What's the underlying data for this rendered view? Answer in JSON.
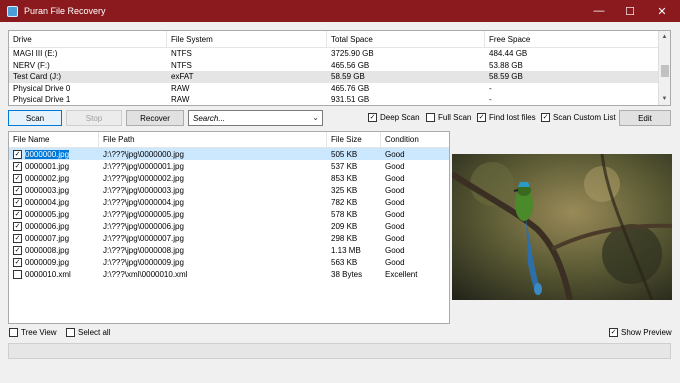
{
  "window": {
    "title": "Puran File Recovery",
    "minimize": "—",
    "maximize": "☐",
    "close": "✕"
  },
  "drives": {
    "columns": [
      "Drive",
      "File System",
      "Total Space",
      "Free Space"
    ],
    "rows": [
      [
        "MAGI III (E:)",
        "NTFS",
        "3725.90 GB",
        "484.44 GB"
      ],
      [
        "NERV (F:)",
        "NTFS",
        "465.56 GB",
        "53.88 GB"
      ],
      [
        "Test Card (J:)",
        "exFAT",
        "58.59 GB",
        "58.59 GB"
      ],
      [
        "Physical Drive 0",
        "RAW",
        "465.76 GB",
        "-"
      ],
      [
        "Physical Drive 1",
        "RAW",
        "931.51 GB",
        "-"
      ]
    ],
    "selected_index": 2
  },
  "toolbar": {
    "scan": "Scan",
    "stop": "Stop",
    "recover": "Recover",
    "search_placeholder": "Search...",
    "deep_scan": "Deep Scan",
    "full_scan": "Full Scan",
    "find_lost_files": "Find lost files",
    "scan_custom_list": "Scan Custom List",
    "edit": "Edit"
  },
  "options": {
    "deep_scan": true,
    "full_scan": false,
    "find_lost_files": true,
    "scan_custom_list": true
  },
  "files": {
    "columns": [
      "File Name",
      "File Path",
      "File Size",
      "Condition"
    ],
    "rows": [
      {
        "name": "0000000.jpg",
        "path": "J:\\???\\jpg\\0000000.jpg",
        "size": "505 KB",
        "condition": "Good",
        "checked": true
      },
      {
        "name": "0000001.jpg",
        "path": "J:\\???\\jpg\\0000001.jpg",
        "size": "537 KB",
        "condition": "Good",
        "checked": true
      },
      {
        "name": "0000002.jpg",
        "path": "J:\\???\\jpg\\0000002.jpg",
        "size": "853 KB",
        "condition": "Good",
        "checked": true
      },
      {
        "name": "0000003.jpg",
        "path": "J:\\???\\jpg\\0000003.jpg",
        "size": "325 KB",
        "condition": "Good",
        "checked": true
      },
      {
        "name": "0000004.jpg",
        "path": "J:\\???\\jpg\\0000004.jpg",
        "size": "782 KB",
        "condition": "Good",
        "checked": true
      },
      {
        "name": "0000005.jpg",
        "path": "J:\\???\\jpg\\0000005.jpg",
        "size": "578 KB",
        "condition": "Good",
        "checked": true
      },
      {
        "name": "0000006.jpg",
        "path": "J:\\???\\jpg\\0000006.jpg",
        "size": "209 KB",
        "condition": "Good",
        "checked": true
      },
      {
        "name": "0000007.jpg",
        "path": "J:\\???\\jpg\\0000007.jpg",
        "size": "298 KB",
        "condition": "Good",
        "checked": true
      },
      {
        "name": "0000008.jpg",
        "path": "J:\\???\\jpg\\0000008.jpg",
        "size": "1.13 MB",
        "condition": "Good",
        "checked": true
      },
      {
        "name": "0000009.jpg",
        "path": "J:\\???\\jpg\\0000009.jpg",
        "size": "563 KB",
        "condition": "Good",
        "checked": true
      },
      {
        "name": "0000010.xml",
        "path": "J:\\???\\xml\\0000010.xml",
        "size": "38 Bytes",
        "condition": "Excellent",
        "checked": false
      }
    ],
    "selected_index": 0
  },
  "footer": {
    "tree_view": "Tree View",
    "select_all": "Select all",
    "show_preview": "Show Preview"
  },
  "footer_state": {
    "tree_view": false,
    "select_all": false,
    "show_preview": true
  },
  "colors": {
    "titlebar": "#8b1a1f",
    "selection": "#0078d7"
  }
}
